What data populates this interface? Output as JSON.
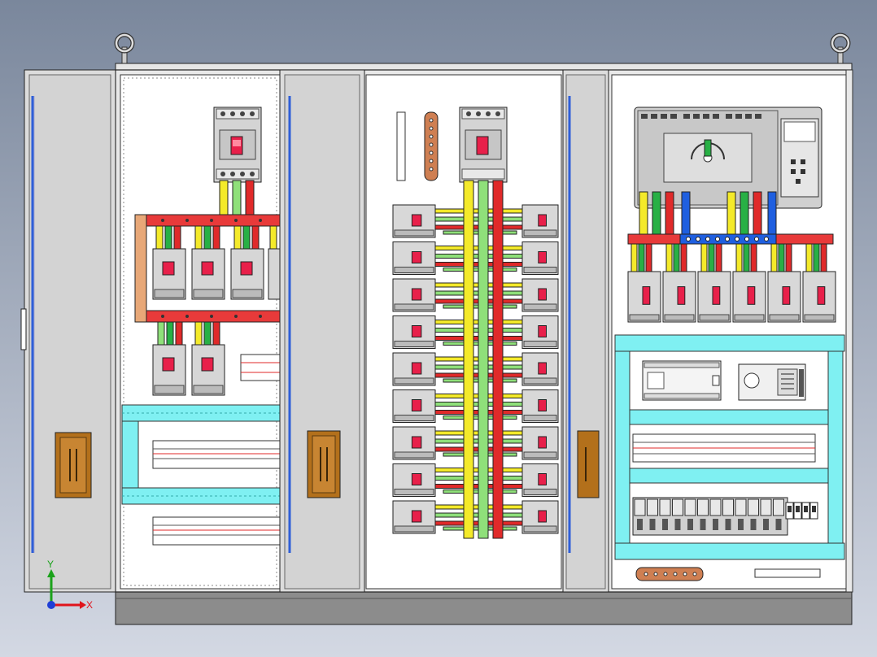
{
  "scene": {
    "background_top": "#7a879c",
    "background_bottom": "#d3d8e3",
    "cabinet_panels": [
      "left",
      "center",
      "right"
    ]
  },
  "triad": {
    "x_label": "X",
    "y_label": "Y",
    "x_color": "#e0141c",
    "y_color": "#1ba21b",
    "origin_color": "#1f3fd6"
  },
  "busbar_colors": {
    "phase_a": "#f4ea2a",
    "phase_b": "#28b045",
    "phase_c": "#e02a2a",
    "neutral": "#1f5fe0",
    "bus_green": "#8fe07a",
    "cyan_trunking": "#7ff0f2",
    "breaker_gray": "#d8d8d8",
    "copper": "#cf7f52",
    "door_handle": "#c07a1e"
  },
  "icons": {
    "lifting_eye": "lifting-eye-icon",
    "coordinate_triad": "xyz-triad-icon"
  }
}
